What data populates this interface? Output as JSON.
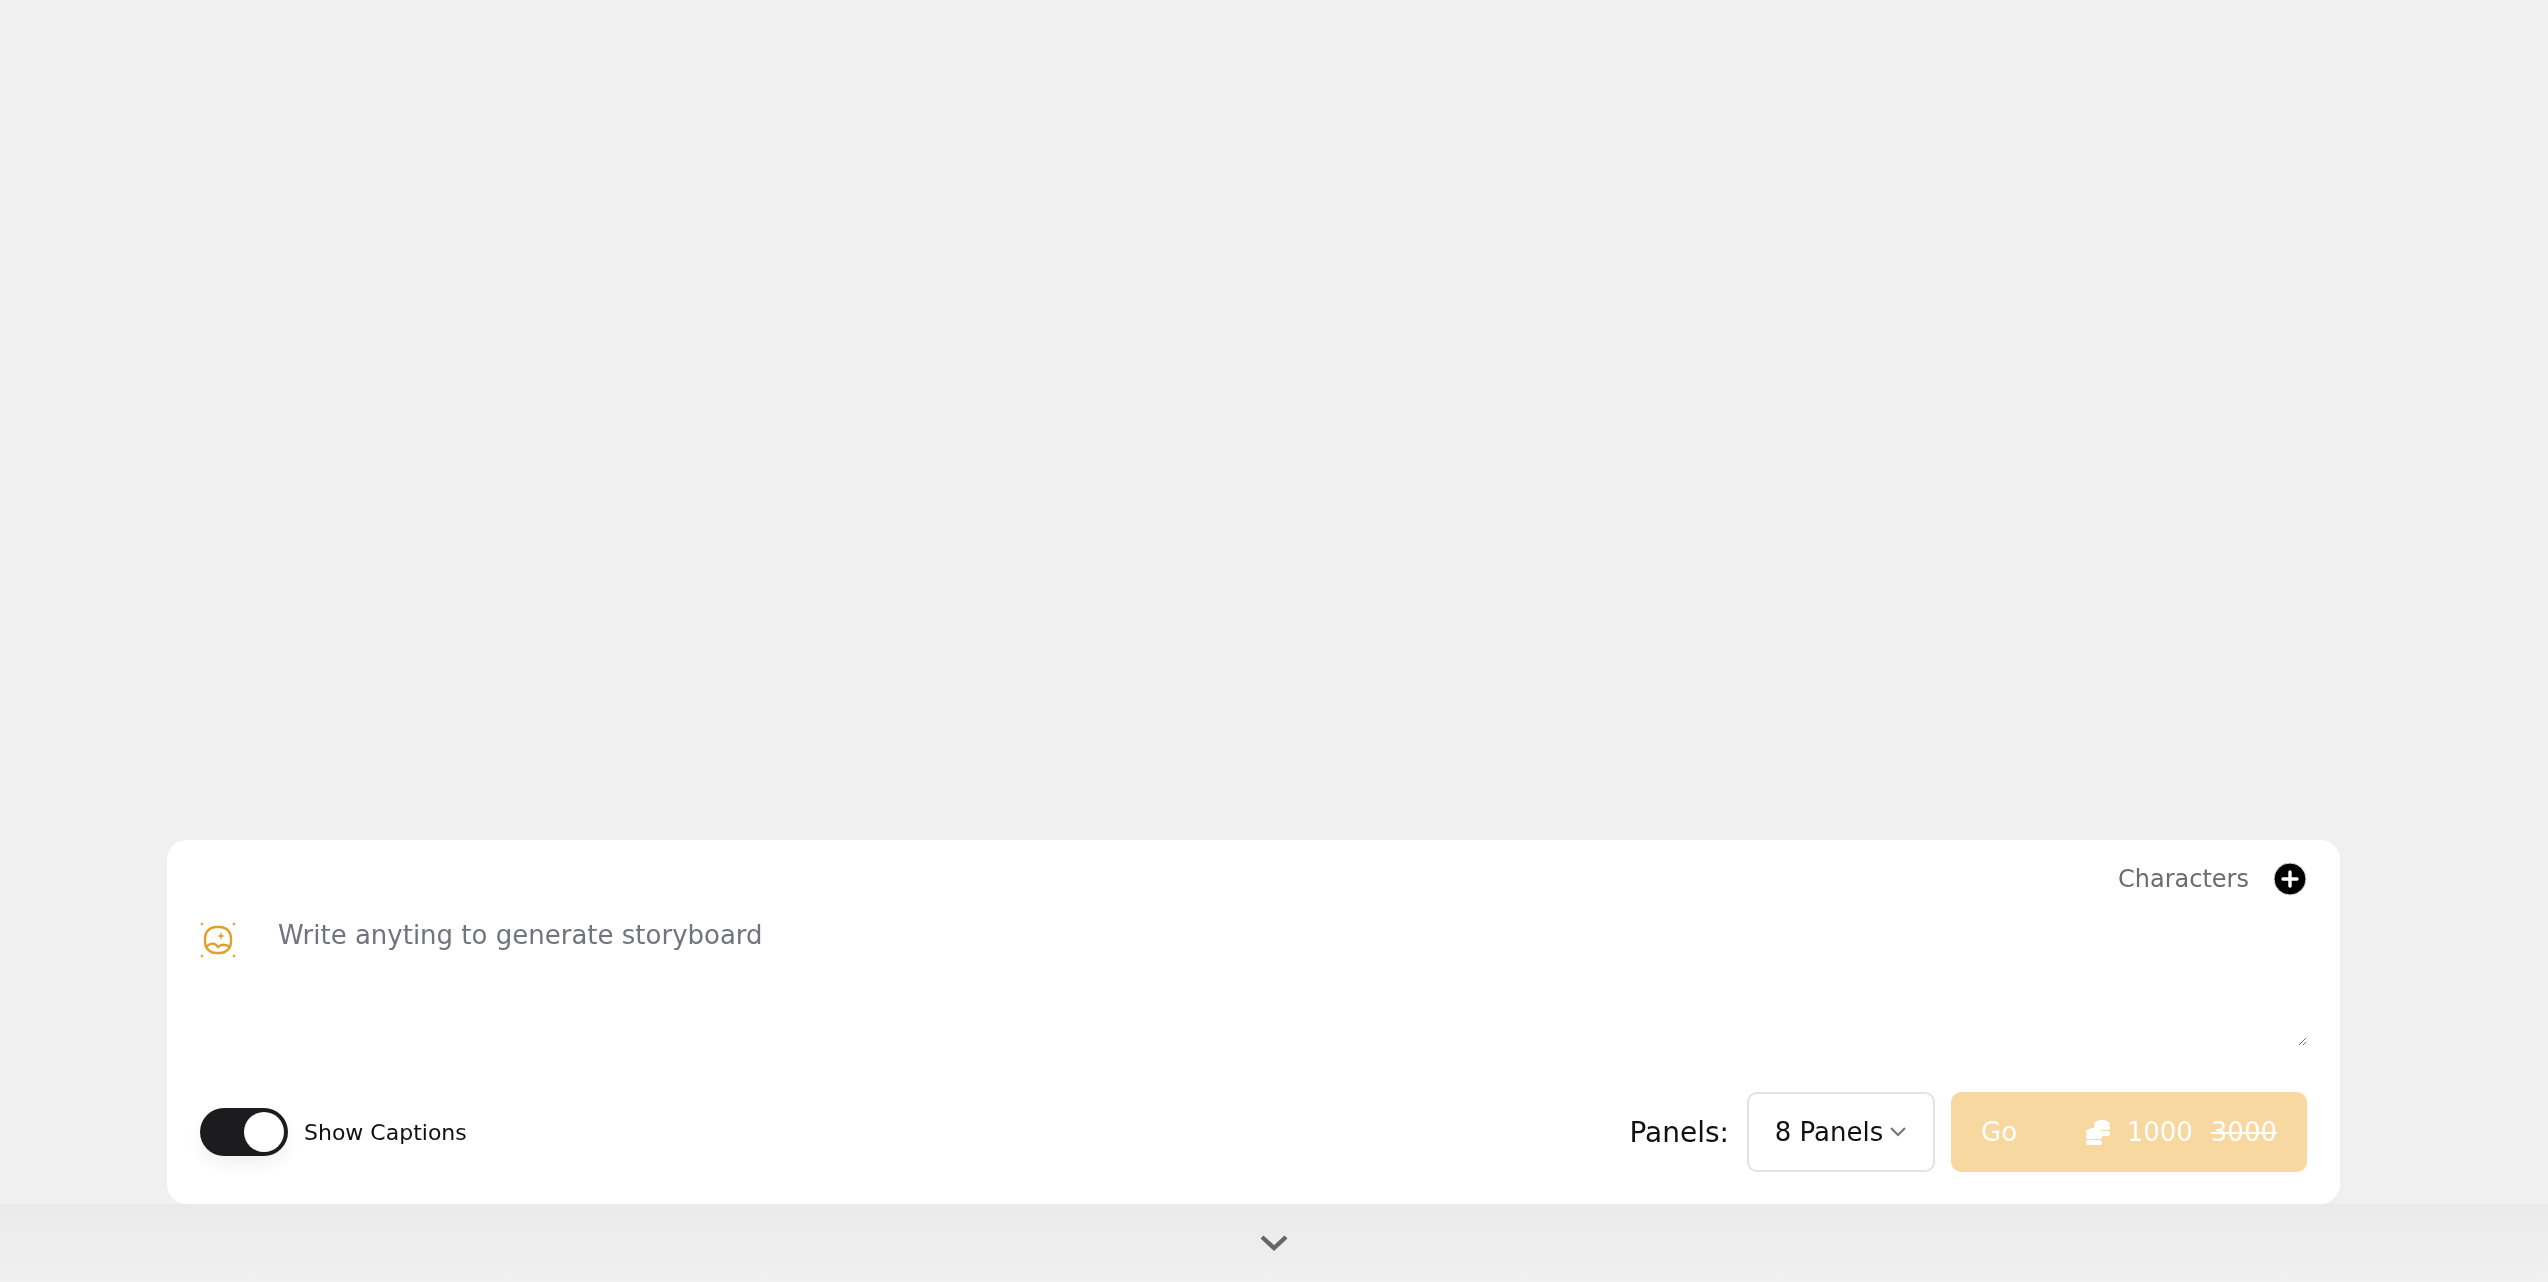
{
  "composer": {
    "characters_label": "Characters",
    "prompt": {
      "placeholder": "Write anyting to generate storyboard"
    },
    "captions_toggle": {
      "label": "Show Captions",
      "on": true
    },
    "panels": {
      "label": "Panels:",
      "value": "8 Panels"
    },
    "go_button": {
      "label": "Go",
      "price": "1000",
      "original_price": "3000",
      "disabled": true
    }
  }
}
